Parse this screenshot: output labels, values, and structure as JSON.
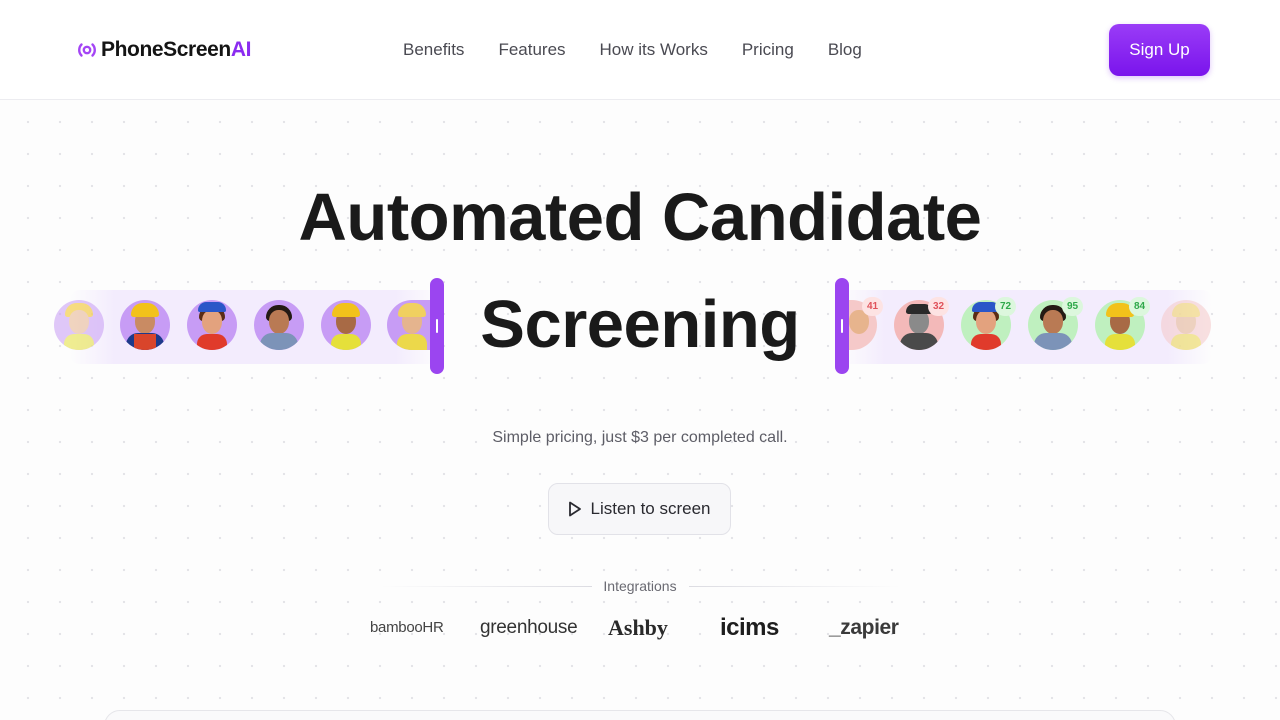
{
  "header": {
    "logo": {
      "name": "PhoneScreen",
      "suffix": "AI",
      "accent": "#8b2cf0"
    },
    "nav": [
      {
        "label": "Benefits"
      },
      {
        "label": "Features"
      },
      {
        "label": "How its Works"
      },
      {
        "label": "Pricing"
      },
      {
        "label": "Blog"
      }
    ],
    "signup_label": "Sign Up"
  },
  "hero": {
    "headline_line1": "Automated Candidate",
    "headline_line2": "Screening",
    "subtitle": "Simple pricing, just $3 per completed call.",
    "cta_label": "Listen to screen",
    "scores": [
      "41",
      "32",
      "72",
      "95",
      "84"
    ]
  },
  "integrations": {
    "label": "Integrations",
    "logos": [
      {
        "name": "bambooHR",
        "display": "bambooHR"
      },
      {
        "name": "greenhouse",
        "display": "greenhouse"
      },
      {
        "name": "Ashby",
        "display": "Ashby"
      },
      {
        "name": "icims",
        "display": "icims"
      },
      {
        "name": "zapier",
        "display": "_zapier"
      }
    ]
  },
  "colors": {
    "accent": "#8b2cf0",
    "score_red": "#e0525a",
    "score_green": "#2fa84a"
  }
}
